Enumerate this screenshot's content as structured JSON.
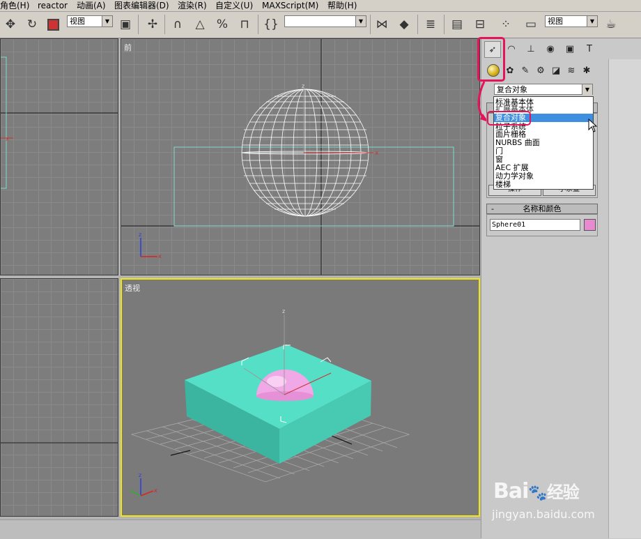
{
  "menubar": {
    "items": [
      "角色(H)",
      "reactor",
      "动画(A)",
      "图表编辑器(D)",
      "渲染(R)",
      "自定义(U)",
      "MAXScript(M)",
      "帮助(H)"
    ]
  },
  "toolbar": {
    "view_select_1": "视图",
    "selection_text": "",
    "view_select_2": "视图"
  },
  "viewports": {
    "front_label": "前",
    "perspective_label": "透视"
  },
  "command_panel": {
    "category_dropdown": "复合对象",
    "dropdown_options": [
      "标准基本体",
      "扩展基本体",
      "复合对象",
      "粒子系统",
      "面片栅格",
      "NURBS 曲面",
      "门",
      "窗",
      "AEC 扩展",
      "动力学对象",
      "楼梯"
    ],
    "selected_option": "复合对象",
    "partial_buttons": [
      "操作",
      "小茶壶"
    ],
    "name_color_rollout": "名称和颜色",
    "rollout_toggle": "-",
    "object_name": "Sphere01",
    "object_color": "#e88ad0"
  },
  "watermark": {
    "brand": "Bai",
    "brand_suffix": "经验",
    "url": "jingyan.baidu.com"
  },
  "colors": {
    "viewport_bg": "#7d7d7d",
    "active_border": "#f3e60d",
    "highlight": "#e2145a",
    "box_teal": "#55dfc6",
    "sphere_pink": "#f0a8e6",
    "selection_blue": "#3f8fe0"
  }
}
